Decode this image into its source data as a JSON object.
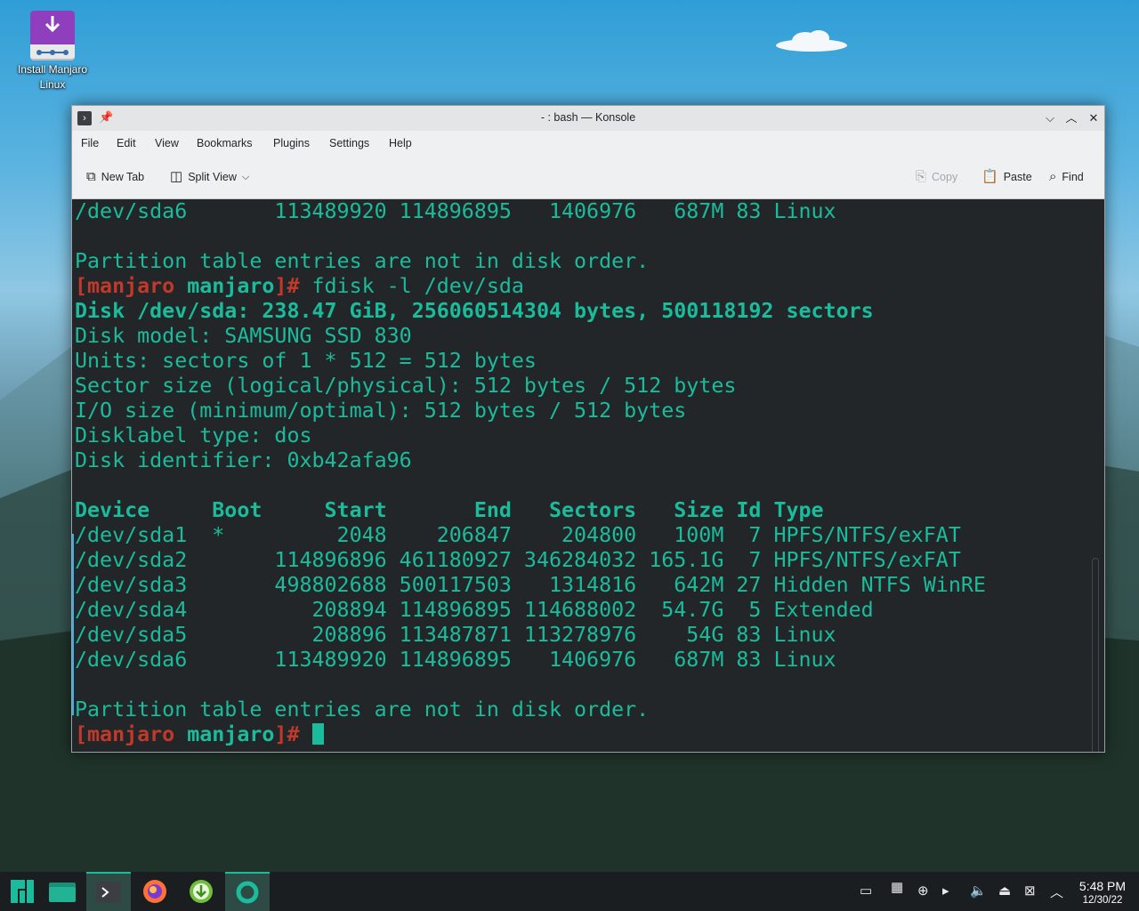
{
  "desktop": {
    "icon_label": "Install Manjaro Linux"
  },
  "window": {
    "title": "- : bash — Konsole",
    "menu": [
      "File",
      "Edit",
      "View",
      "Bookmarks",
      "Plugins",
      "Settings",
      "Help"
    ],
    "toolbar": {
      "new_tab": "New Tab",
      "split_view": "Split View",
      "copy": "Copy",
      "paste": "Paste",
      "find": "Find"
    }
  },
  "terminal": {
    "lines": [
      "/dev/sda6       113489920 114896895   1406976   687M 83 Linux",
      "",
      "Partition table entries are not in disk order.",
      "fdisk -l /dev/sda",
      "Disk /dev/sda: 238.47 GiB, 256060514304 bytes, 500118192 sectors",
      "Disk model: SAMSUNG SSD 830",
      "Units: sectors of 1 * 512 = 512 bytes",
      "Sector size (logical/physical): 512 bytes / 512 bytes",
      "I/O size (minimum/optimal): 512 bytes / 512 bytes",
      "Disklabel type: dos",
      "Disk identifier: 0xb42afa96",
      "",
      "Device     Boot     Start       End   Sectors   Size Id Type",
      "/dev/sda1  *         2048    206847    204800   100M  7 HPFS/NTFS/exFAT",
      "/dev/sda2       114896896 461180927 346284032 165.1G  7 HPFS/NTFS/exFAT",
      "/dev/sda3       498802688 500117503   1314816   642M 27 Hidden NTFS WinRE",
      "/dev/sda4          208894 114896895 114688002  54.7G  5 Extended",
      "/dev/sda5          208896 113487871 113278976    54G 83 Linux",
      "/dev/sda6       113489920 114896895   1406976   687M 83 Linux",
      "",
      "Partition table entries are not in disk order.",
      ""
    ],
    "prompt_open": "[manjaro ",
    "prompt_user": "manjaro",
    "prompt_close": "]# "
  },
  "clock": {
    "time": "5:48 PM",
    "date": "12/30/22"
  }
}
